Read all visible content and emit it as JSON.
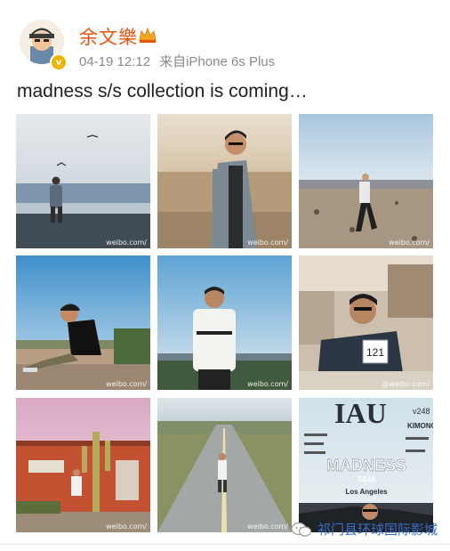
{
  "post": {
    "username": "余文樂",
    "timestamp": "04-19 12:12",
    "source": "来自iPhone 6s Plus",
    "text": "madness s/s collection is coming…",
    "verified_badge": "v",
    "crown_icon": "crown-icon"
  },
  "photos": [
    {
      "label": "beach-walk-photo",
      "watermark": "weibo.com/"
    },
    {
      "label": "desert-jacket-photo",
      "watermark": "weibo.com/"
    },
    {
      "label": "desert-distance-photo",
      "watermark": "weibo.com/"
    },
    {
      "label": "sitting-ledge-photo",
      "watermark": "weibo.com/"
    },
    {
      "label": "city-overlook-photo",
      "watermark": "weibo.com/"
    },
    {
      "label": "cafe-seated-photo",
      "watermark": "@weibo.com/"
    },
    {
      "label": "cactus-house-photo",
      "watermark": "weibo.com/"
    },
    {
      "label": "road-walk-photo",
      "watermark": "weibo.com/"
    },
    {
      "label": "magazine-cover-photo",
      "watermark": ""
    }
  ],
  "magazine": {
    "masthead": "IAU",
    "issue": "v248",
    "headline": "MADNESS",
    "subhead": "SS16",
    "city": "Los Angeles",
    "side_label": "KIMONO"
  },
  "cafe_number": "121",
  "footer_watermark": "祁门县环球国际影城",
  "colors": {
    "username": "#e8530e",
    "meta": "#8a8a8a",
    "footer": "#3a6ec8"
  }
}
